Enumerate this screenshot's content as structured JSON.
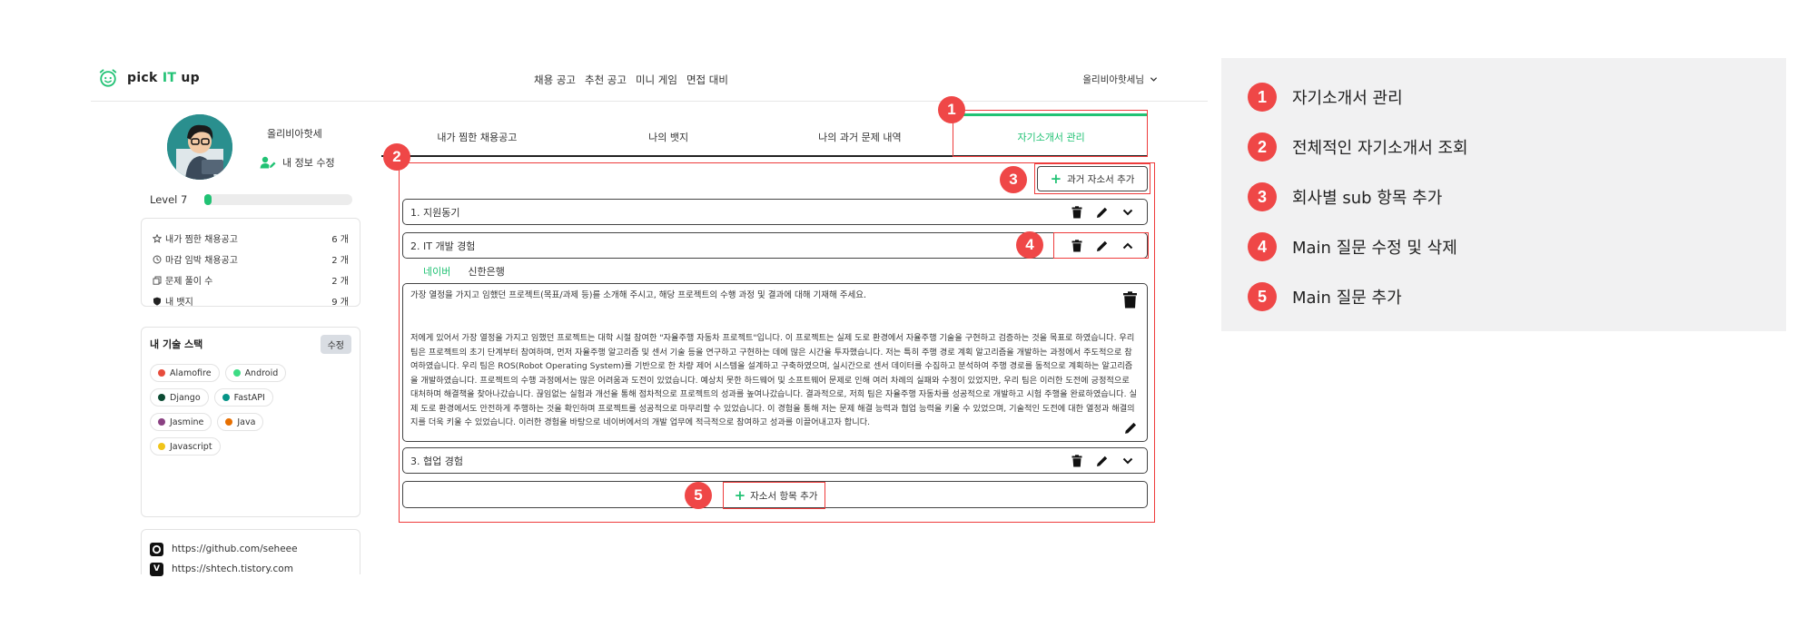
{
  "header": {
    "logo_text_pre": "pick ",
    "logo_text_it": "IT",
    "logo_text_post": " up",
    "nav": [
      "채용 공고",
      "추천 공고",
      "미니 게임",
      "면접 대비"
    ],
    "user_name": "올리비아핫세님"
  },
  "sidebar": {
    "profile_name": "올리비아핫세",
    "edit_info_label": "내 정보 수정",
    "level_label": "Level 7",
    "level_progress": 0.05,
    "stats": [
      {
        "label": "내가 찜한 채용공고",
        "value": "6 개",
        "icon": "star-icon"
      },
      {
        "label": "마감 임박 채용공고",
        "value": "2 개",
        "icon": "clock-icon"
      },
      {
        "label": "문제 풀이 수",
        "value": "2 개",
        "icon": "copy-icon"
      },
      {
        "label": "내 뱃지",
        "value": "9 개",
        "icon": "shield-icon"
      }
    ],
    "skills_title": "내 기술 스택",
    "skills_edit_label": "수정",
    "skills": [
      {
        "name": "Alamofire",
        "color": "#e74c3c"
      },
      {
        "name": "Android",
        "color": "#3ddc84"
      },
      {
        "name": "Django",
        "color": "#0c4b33"
      },
      {
        "name": "FastAPI",
        "color": "#059487"
      },
      {
        "name": "Jasmine",
        "color": "#8a4182"
      },
      {
        "name": "Java",
        "color": "#e76f00"
      },
      {
        "name": "Javascript",
        "color": "#f0c419"
      }
    ],
    "links": [
      {
        "icon": "github-icon",
        "url": "https://github.com/seheee"
      },
      {
        "icon": "tistory-icon",
        "url": "https://shtech.tistory.com"
      }
    ]
  },
  "tabs": [
    "내가 찜한 채용공고",
    "나의 뱃지",
    "나의 과거 문제 내역",
    "자기소개서 관리"
  ],
  "main": {
    "add_past_label": "과거 자소서 추가",
    "questions": [
      {
        "title": "1. 지원동기"
      },
      {
        "title": "2. IT 개발 경험"
      },
      {
        "title": "3. 협업 경험"
      }
    ],
    "companies": [
      "네이버",
      "신한은행"
    ],
    "answer_question": "가장 열정을 가지고 임했던 프로젝트(목표/과제 등)를 소개해 주시고, 해당 프로젝트의 수행 과정 및 결과에 대해 기재해 주세요.",
    "answer_body": "저에게 있어서 가장 열정을 가지고 임했던 프로젝트는 대학 시절 참여한 \"자율주행 자동차 프로젝트\"입니다. 이 프로젝트는 실제 도로 환경에서 자율주행 기술을 구현하고 검증하는 것을 목표로 하였습니다. 우리 팀은 프로젝트의 초기 단계부터 참여하며, 먼저 자율주행 알고리즘 및 센서 기술 등을 연구하고 구현하는 데에 많은 시간을 투자했습니다. 저는 특히 주행 경로 계획 알고리즘을 개발하는 과정에서 주도적으로 참여하였습니다. 우리 팀은 ROS(Robot Operating System)를 기반으로 한 차량 제어 시스템을 설계하고 구축하였으며, 실시간으로 센서 데이터를 수집하고 분석하여 주행 경로를 동적으로 계획하는 알고리즘을 개발하였습니다. 프로젝트의 수행 과정에서는 많은 어려움과 도전이 있었습니다. 예상치 못한 하드웨어 및 소프트웨어 문제로 인해 여러 차례의 실패와 수정이 있었지만, 우리 팀은 이러한 도전에 긍정적으로 대처하며 해결책을 찾아나갔습니다. 끊임없는 실험과 개선을 통해 점차적으로 프로젝트의 성과를 높여나갔습니다. 결과적으로, 저희 팀은 자율주행 자동차를 성공적으로 개발하고 시험 주행을 완료하였습니다. 실제 도로 환경에서도 안전하게 주행하는 것을 확인하며 프로젝트를 성공적으로 마무리할 수 있었습니다. 이 경험을 통해 저는 문제 해결 능력과 협업 능력을 키울 수 있었으며, 기술적인 도전에 대한 열정과 해결의지를 더욱 키울 수 있었습니다. 이러한 경험을 바탕으로 네이버에서의 개발 업무에 적극적으로 참여하고 성과를 이끌어내고자 합니다.",
    "add_item_label": "자소서 항목 추가"
  },
  "badges": [
    "1",
    "2",
    "3",
    "4",
    "5"
  ],
  "legend": [
    {
      "num": "1",
      "text": "자기소개서 관리"
    },
    {
      "num": "2",
      "text": "전체적인 자기소개서 조회"
    },
    {
      "num": "3",
      "text": "회사별 sub 항목 추가"
    },
    {
      "num": "4",
      "text": "Main 질문 수정 및 삭제"
    },
    {
      "num": "5",
      "text": "Main 질문 추가"
    }
  ],
  "colors": {
    "accent": "#21c274",
    "annotation_red": "#ef4747"
  }
}
